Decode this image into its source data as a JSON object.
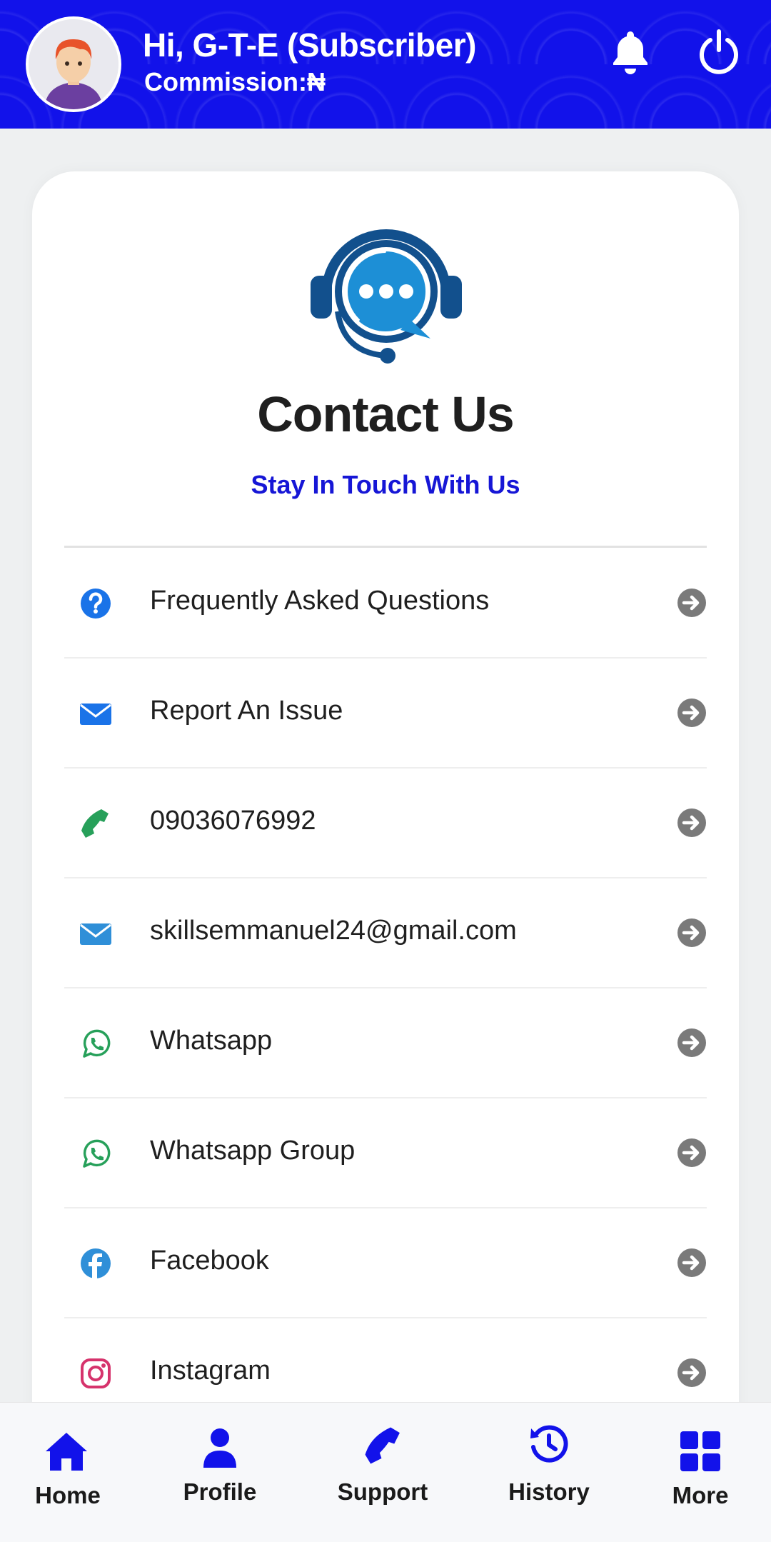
{
  "header": {
    "greeting": "Hi, G-T-E (Subscriber)",
    "commission": "Commission:₦",
    "icons": [
      "avatar",
      "bell-icon",
      "power-icon"
    ]
  },
  "card": {
    "title": "Contact Us",
    "subtitle": "Stay In Touch With Us",
    "items": [
      {
        "label": "Frequently Asked Questions",
        "icon": "question-circle-icon",
        "color": "#1a73e8"
      },
      {
        "label": "Report An Issue",
        "icon": "envelope-icon",
        "color": "#1a73e8"
      },
      {
        "label": "09036076992",
        "icon": "phone-icon",
        "color": "#27a05a"
      },
      {
        "label": "skillsemmanuel24@gmail.com",
        "icon": "envelope-icon",
        "color": "#2f8fd8"
      },
      {
        "label": "Whatsapp",
        "icon": "whatsapp-icon",
        "color": "#27a05a"
      },
      {
        "label": "Whatsapp Group",
        "icon": "whatsapp-icon",
        "color": "#27a05a"
      },
      {
        "label": "Facebook",
        "icon": "facebook-icon",
        "color": "#2f8fd8"
      },
      {
        "label": "Instagram",
        "icon": "instagram-icon",
        "color": "#d6336c"
      }
    ]
  },
  "nav": {
    "items": [
      {
        "label": "Home",
        "icon": "home-icon"
      },
      {
        "label": "Profile",
        "icon": "user-icon"
      },
      {
        "label": "Support",
        "icon": "phone-icon"
      },
      {
        "label": "History",
        "icon": "history-icon"
      },
      {
        "label": "More",
        "icon": "grid-icon"
      }
    ]
  },
  "colors": {
    "accent": "#1212ea",
    "arrow": "#7a7a7a"
  }
}
